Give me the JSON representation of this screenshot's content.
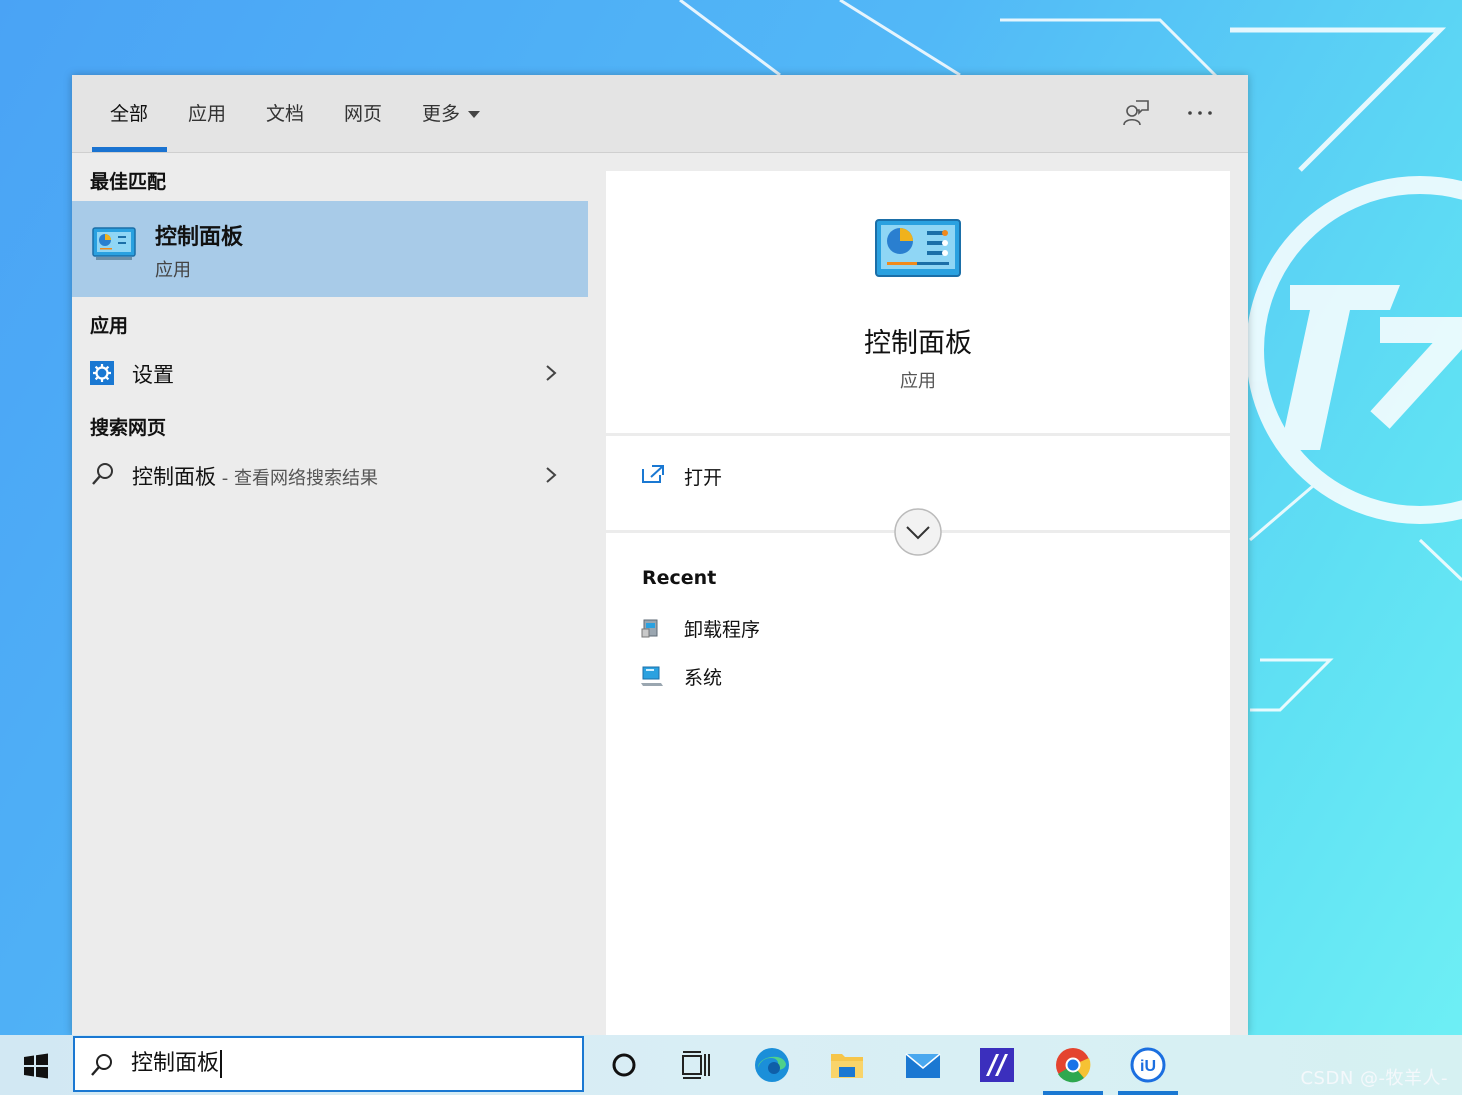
{
  "tabs": [
    {
      "label": "全部",
      "active": true
    },
    {
      "label": "应用"
    },
    {
      "label": "文档"
    },
    {
      "label": "网页"
    },
    {
      "label": "更多"
    }
  ],
  "topbar_icons": [
    "feedback-icon",
    "more-options-icon"
  ],
  "left": {
    "best_match_header": "最佳匹配",
    "best_match": {
      "title": "控制面板",
      "subtitle": "应用",
      "icon": "control-panel-icon"
    },
    "apps_header": "应用",
    "apps": [
      {
        "label": "设置",
        "icon": "settings-gear-icon"
      }
    ],
    "web_header": "搜索网页",
    "web": [
      {
        "label": "控制面板",
        "suffix": " - 查看网络搜索结果",
        "icon": "search-icon"
      }
    ]
  },
  "right": {
    "title": "控制面板",
    "subtitle": "应用",
    "open_label": "打开",
    "recent_header": "Recent",
    "recent": [
      {
        "label": "卸载程序",
        "icon": "uninstall-program-icon"
      },
      {
        "label": "系统",
        "icon": "system-icon"
      }
    ]
  },
  "search": {
    "value": "控制面板"
  },
  "taskbar": {
    "icons": [
      "windows-start-icon",
      "cortana-icon",
      "task-view-icon",
      "edge-icon",
      "file-explorer-icon",
      "mail-icon",
      "app-icon",
      "chrome-icon",
      "iu-app-icon"
    ]
  },
  "watermark": "CSDN @-牧羊人-",
  "colors": {
    "accent": "#1a73d1",
    "selected": "#a8cbe8"
  }
}
